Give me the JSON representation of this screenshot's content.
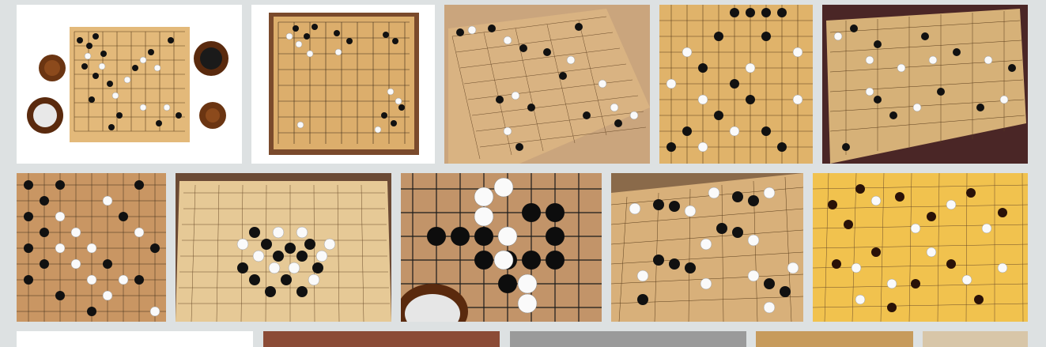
{
  "gallery": {
    "background": "#dde1e2",
    "tiles": [
      {
        "icon": "go-board-overhead-with-bowls-image",
        "bg": "#ffffff",
        "board": "#e3b97a"
      },
      {
        "icon": "go-board-framed-image",
        "bg": "#ffffff",
        "board": "#dcae6c"
      },
      {
        "icon": "go-board-angled-wood-table-image",
        "bg": "#caa57d",
        "board": "#d9b382"
      },
      {
        "icon": "go-board-closeup-dense-image",
        "bg": "#e0b36a",
        "board": "#e0b36a"
      },
      {
        "icon": "go-board-dark-background-image",
        "bg": "#4a2626",
        "board": "#d6b178"
      },
      {
        "icon": "go-board-dense-game-image",
        "bg": "#c99663",
        "board": "#c99663"
      },
      {
        "icon": "go-board-light-wood-image",
        "bg": "#6b4a35",
        "board": "#e6c996"
      },
      {
        "icon": "go-board-large-grid-closeup-image",
        "bg": "#b48559",
        "board": "#c29469"
      },
      {
        "icon": "go-board-perspective-image",
        "bg": "#8a6a4a",
        "board": "#d8b07a"
      },
      {
        "icon": "go-board-yellow-image",
        "bg": "#f1c24e",
        "board": "#f1c24e"
      },
      {
        "icon": "partial-image",
        "bg": "#ffffff",
        "board": "#ffffff"
      },
      {
        "icon": "partial-image",
        "bg": "#8b4b36",
        "board": "#8b4b36"
      },
      {
        "icon": "partial-image",
        "bg": "#9a9a9a",
        "board": "#9a9a9a"
      },
      {
        "icon": "partial-image",
        "bg": "#c79b5c",
        "board": "#c79b5c"
      },
      {
        "icon": "partial-image",
        "bg": "#d8c6a8",
        "board": "#d8c6a8"
      }
    ]
  }
}
